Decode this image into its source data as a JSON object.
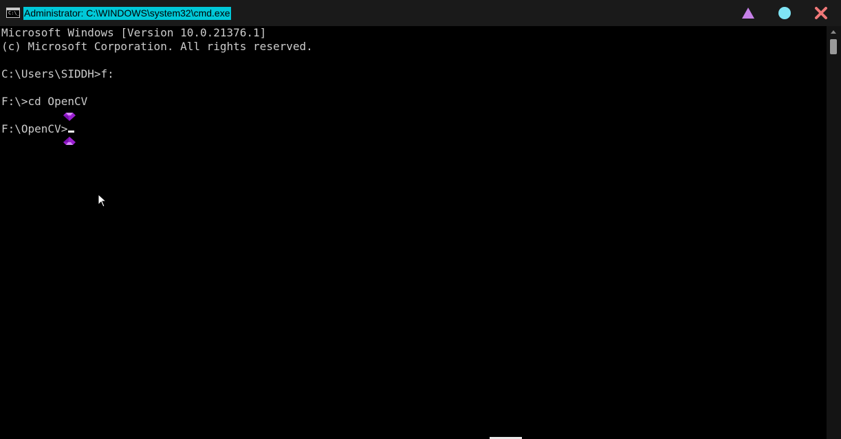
{
  "window": {
    "title": "Administrator: C:\\WINDOWS\\system32\\cmd.exe",
    "app_icon_glyph": "C:\\_",
    "title_highlight_color": "#00c8d8",
    "controls": {
      "minimize_icon": "triangle-icon",
      "maximize_icon": "circle-icon",
      "close_icon": "x-icon",
      "minimize_color": "#c680e8",
      "maximize_color": "#7fe5f5",
      "close_color": "#f07878"
    }
  },
  "terminal": {
    "lines": [
      "Microsoft Windows [Version 10.0.21376.1]",
      "(c) Microsoft Corporation. All rights reserved.",
      "",
      "C:\\Users\\SIDDH>f:",
      "",
      "F:\\>cd OpenCV",
      "",
      "F:\\OpenCV>"
    ],
    "text_color": "#cccccc",
    "background_color": "#000000"
  }
}
